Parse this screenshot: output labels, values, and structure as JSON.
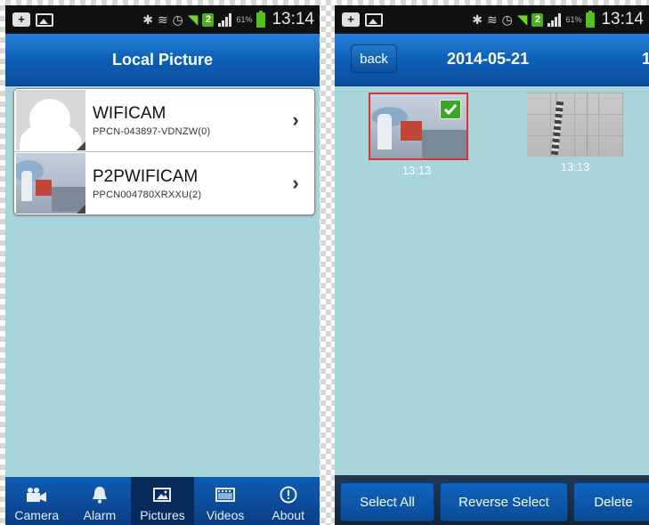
{
  "status_bar": {
    "time": "13:14",
    "battery_percent": "61%",
    "sim_slot": "2",
    "icons": [
      "notification-box-icon",
      "image-icon",
      "bluetooth-icon",
      "vibrate-icon",
      "alarm-clock-icon",
      "wifi-icon",
      "sim-icon",
      "signal-icon",
      "battery-icon"
    ]
  },
  "left_screen": {
    "title": "Local Picture",
    "cameras": [
      {
        "name": "WIFICAM",
        "id": "PPCN-043897-VDNZW(0)",
        "thumbnail": "default-avatar"
      },
      {
        "name": "P2PWIFICAM",
        "id": "PPCN004780XRXXU(2)",
        "thumbnail": "camera-snapshot"
      }
    ],
    "tabs": [
      {
        "label": "Camera",
        "icon": "camera-icon",
        "active": false
      },
      {
        "label": "Alarm",
        "icon": "alarm-bell-icon",
        "active": false
      },
      {
        "label": "Pictures",
        "icon": "pictures-icon",
        "active": true
      },
      {
        "label": "Videos",
        "icon": "videos-icon",
        "active": false
      },
      {
        "label": "About",
        "icon": "about-info-icon",
        "active": false
      }
    ],
    "chevron": "›"
  },
  "right_screen": {
    "back_label": "back",
    "date": "2014-05-21",
    "page_count": "1",
    "photos": [
      {
        "time": "13:13",
        "selected": true
      },
      {
        "time": "13:13",
        "selected": false
      }
    ],
    "actions": {
      "select_all": "Select All",
      "reverse_select": "Reverse Select",
      "delete": "Delete"
    }
  },
  "colors": {
    "content_bg": "#a8d5dc",
    "header_blue": "#0d5fb8",
    "selected_border": "#e03030",
    "check_green": "#3aa52a"
  }
}
